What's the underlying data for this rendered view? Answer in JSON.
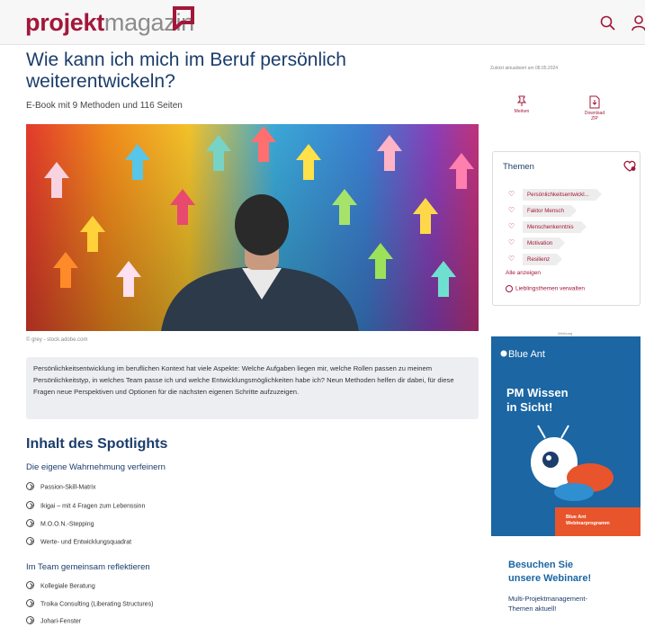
{
  "header": {
    "logo_bold": "projekt",
    "logo_light": "magazin",
    "search_icon": "search-icon",
    "user_icon": "user-icon"
  },
  "article": {
    "title": "Wie kann ich mich im Beruf persönlich weiterentwickeln?",
    "subtitle": "E-Book mit 9 Methoden und 116 Seiten",
    "image_credit": "© grey - stock.adobe.com",
    "intro": "Persönlichkeitsentwicklung im beruflichen Kontext hat viele Aspekte: Welche Aufgaben liegen mir, welche Rollen passen zu meinem Persönlichkeitstyp, in welches Team passe ich und welche Entwicklungsmöglichkeiten habe ich? Neun Methoden helfen dir dabei, für diese Fragen neue Perspektiven und Optionen für die nächsten eigenen Schritte aufzuzeigen."
  },
  "contents": {
    "heading": "Inhalt des Spotlights",
    "groups": [
      {
        "title": "Die eigene Wahrnehmung verfeinern",
        "items": [
          "Passion-Skill-Matrix",
          "Ikigai – mit 4 Fragen zum Lebenssinn",
          "M.O.O.N.-Stepping",
          "Werte- und Entwicklungsquadrat"
        ]
      },
      {
        "title": "Im Team gemeinsam reflektieren",
        "items": [
          "Kollegiale Beratung",
          "Troika Consulting (Liberating Structures)",
          "Johari-Fenster"
        ]
      }
    ]
  },
  "sidebar": {
    "updated": "Zuletzt aktualisiert am 08.05.2024",
    "merken_label": "Merken",
    "download_label_1": "Download",
    "download_label_2": "ZIP",
    "themes_title": "Themen",
    "themes": [
      "Persönlichkeitsentwickl...",
      "Faktor Mensch",
      "Menschenkenntnis",
      "Motivation",
      "Resilienz"
    ],
    "show_all": "Alle anzeigen",
    "manage": "Lieblingsthemen verwalten"
  },
  "ad": {
    "label": "Werbung",
    "brand": "Blue Ant",
    "headline_1": "PM Wissen",
    "headline_2": "in Sicht!",
    "banner_1": "Blue Ant",
    "banner_2": "Webinarprogramm",
    "cta_1": "Besuchen Sie",
    "cta_2": "unsere Webinare!",
    "text_1": "Multi-Projektmanagement-",
    "text_2": "Themen aktuell!"
  },
  "colors": {
    "brand": "#a3173a",
    "title_blue": "#1b3d6b",
    "ad_blue": "#1b66a3",
    "ad_orange": "#e8542b"
  }
}
